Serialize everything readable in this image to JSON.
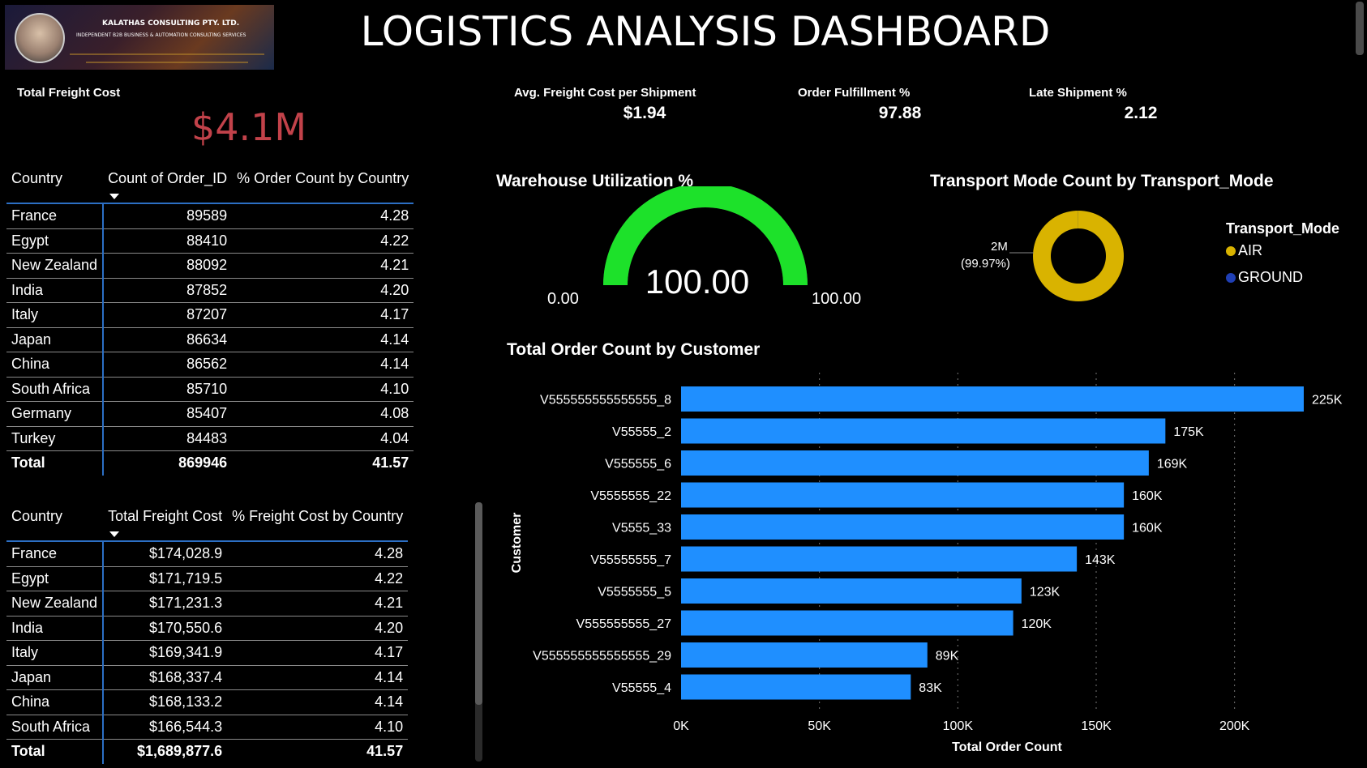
{
  "header": {
    "title": "LOGISTICS ANALYSIS DASHBOARD",
    "logo": {
      "company_name": "KALATHAS CONSULTING PTY. LTD.",
      "tagline": "INDEPENDENT B2B BUSINESS & AUTOMATION CONSULTING SERVICES"
    }
  },
  "kpis": {
    "total_freight_cost": {
      "label": "Total Freight Cost",
      "value": "$4.1M"
    },
    "avg_freight_cost": {
      "label": "Avg. Freight Cost per Shipment",
      "value": "$1.94"
    },
    "order_fulfillment": {
      "label": "Order Fulfillment %",
      "value": "97.88"
    },
    "late_shipment": {
      "label": "Late Shipment %",
      "value": "2.12"
    }
  },
  "order_table": {
    "headers": [
      "Country",
      "Count of Order_ID",
      "% Order Count by Country"
    ],
    "rows": [
      [
        "France",
        "89589",
        "4.28"
      ],
      [
        "Egypt",
        "88410",
        "4.22"
      ],
      [
        "New Zealand",
        "88092",
        "4.21"
      ],
      [
        "India",
        "87852",
        "4.20"
      ],
      [
        "Italy",
        "87207",
        "4.17"
      ],
      [
        "Japan",
        "86634",
        "4.14"
      ],
      [
        "China",
        "86562",
        "4.14"
      ],
      [
        "South Africa",
        "85710",
        "4.10"
      ],
      [
        "Germany",
        "85407",
        "4.08"
      ],
      [
        "Turkey",
        "84483",
        "4.04"
      ]
    ],
    "total": [
      "Total",
      "869946",
      "41.57"
    ]
  },
  "freight_table": {
    "headers": [
      "Country",
      "Total Freight Cost",
      "% Freight Cost by Country"
    ],
    "rows": [
      [
        "France",
        "$174,028.9",
        "4.28"
      ],
      [
        "Egypt",
        "$171,719.5",
        "4.22"
      ],
      [
        "New Zealand",
        "$171,231.3",
        "4.21"
      ],
      [
        "India",
        "$170,550.6",
        "4.20"
      ],
      [
        "Italy",
        "$169,341.9",
        "4.17"
      ],
      [
        "Japan",
        "$168,337.4",
        "4.14"
      ],
      [
        "China",
        "$168,133.2",
        "4.14"
      ],
      [
        "South Africa",
        "$166,544.3",
        "4.10"
      ]
    ],
    "total": [
      "Total",
      "$1,689,877.6",
      "41.57"
    ]
  },
  "gauge": {
    "title": "Warehouse Utilization %",
    "value": 100.0,
    "value_label": "100.00",
    "min_label": "0.00",
    "max_label": "100.00",
    "min": 0,
    "max": 100,
    "color": "#1de12a"
  },
  "donut": {
    "title": "Transport Mode Count by Transport_Mode",
    "slice_value_label": "2M",
    "slice_pct_label": "(99.97%)",
    "legend_title": "Transport_Mode",
    "legend": [
      {
        "label": "AIR",
        "color": "#d9b300",
        "share": 99.97
      },
      {
        "label": "GROUND",
        "color": "#1f3fb5",
        "share": 0.03
      }
    ]
  },
  "chart_data": {
    "type": "bar",
    "orientation": "horizontal",
    "title": "Total Order Count by Customer",
    "xlabel": "Total Order Count",
    "ylabel": "Customer",
    "categories": [
      "V555555555555555_8",
      "V55555_2",
      "V555555_6",
      "V5555555_22",
      "V5555_33",
      "V55555555_7",
      "V5555555_5",
      "V555555555_27",
      "V555555555555555_29",
      "V55555_4"
    ],
    "values": [
      225000,
      175000,
      169000,
      160000,
      160000,
      143000,
      123000,
      120000,
      89000,
      83000
    ],
    "data_labels": [
      "225K",
      "175K",
      "169K",
      "160K",
      "160K",
      "143K",
      "123K",
      "120K",
      "89K",
      "83K"
    ],
    "xticks": [
      "0K",
      "50K",
      "100K",
      "150K",
      "200K"
    ],
    "xtick_values": [
      0,
      50000,
      100000,
      150000,
      200000
    ],
    "xlim": [
      0,
      225000
    ],
    "grid": "vertical dotted",
    "bar_color": "#1f8fff"
  }
}
